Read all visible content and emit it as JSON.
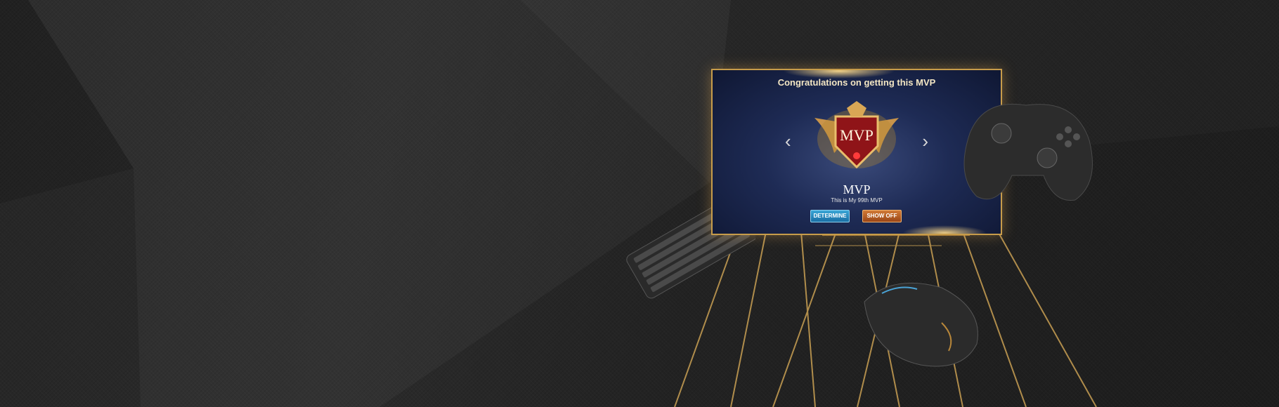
{
  "popup": {
    "title": "Congratulations on getting this MVP",
    "emblem_text": "MVP",
    "mvp_label": "MVP",
    "subtitle": "This is My 99th MVP",
    "determine_label": "DETERMINE",
    "show_off_label": "SHOW OFF",
    "prev_glyph": "‹",
    "next_glyph": "›"
  },
  "colors": {
    "gold_accent": "#c79c4a",
    "determine_blue": "#2a8cc4",
    "show_off_orange": "#c0652a",
    "background": "#262626"
  },
  "icons": {
    "emblem": "mvp-shield-icon",
    "prev": "chevron-left-icon",
    "next": "chevron-right-icon"
  }
}
